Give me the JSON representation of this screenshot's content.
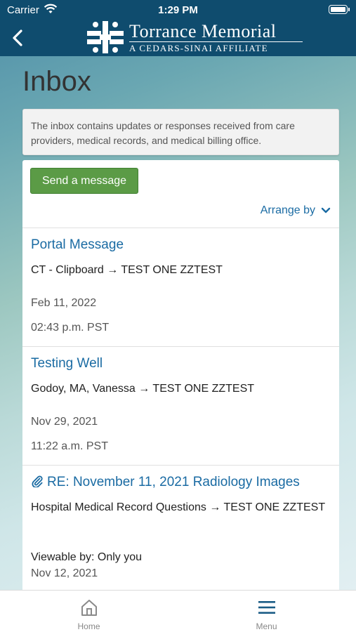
{
  "status_bar": {
    "carrier": "Carrier",
    "time": "1:29 PM"
  },
  "header": {
    "title": "Torrance Memorial",
    "subtitle": "A CEDARS-SINAI AFFILIATE"
  },
  "page": {
    "title": "Inbox"
  },
  "info": {
    "text": "The inbox contains updates or responses received from care providers, medical records, and medical billing office."
  },
  "actions": {
    "send_label": "Send a message",
    "arrange_label": "Arrange by"
  },
  "messages": [
    {
      "subject": "Portal Message",
      "route": "CT - Clipboard → TEST ONE ZZTEST",
      "date": "Feb 11, 2022",
      "time": "02:43 p.m. PST"
    },
    {
      "subject": "Testing Well",
      "route": "Godoy, MA, Vanessa → TEST ONE ZZTEST",
      "date": "Nov 29, 2021",
      "time": "11:22 a.m. PST"
    },
    {
      "subject": "RE: November 11, 2021 Radiology Images",
      "route": "Hospital Medical Record Questions → TEST ONE ZZTEST",
      "viewable": "Viewable by: Only you",
      "date": "Nov 12, 2021"
    }
  ],
  "tabbar": {
    "home": "Home",
    "menu": "Menu"
  },
  "colors": {
    "header": "#0f4c6e",
    "link": "#1a6ba3",
    "button": "#5b9b46"
  },
  "icons": {
    "back": "chevron-left-icon",
    "arrange": "chevron-down-icon",
    "attachment": "paperclip-icon",
    "home": "home-icon",
    "menu": "hamburger-icon"
  }
}
